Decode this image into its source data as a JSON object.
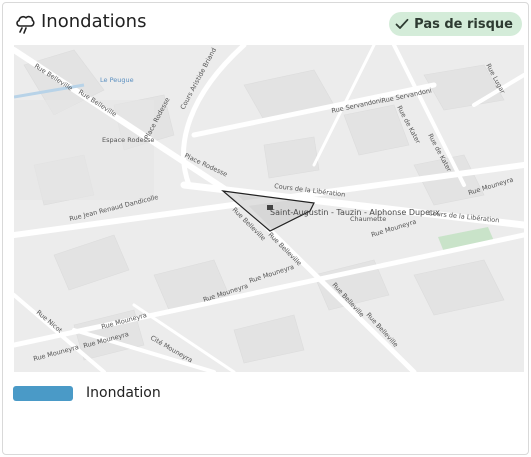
{
  "card": {
    "title": "Inondations",
    "title_icon": "cloud-rain-icon",
    "status": {
      "label": "Pas de risque",
      "icon": "check-icon",
      "color": "#d4ecd9"
    }
  },
  "map": {
    "parcel_label": "Saint-Augustin - Tauzin - Alphonse Dupeux",
    "district_label": "Chaumette",
    "landmarks": [
      "Le Peugue",
      "Espace Rodesse"
    ],
    "streets": [
      "Rue Belleville",
      "Rue Belleville",
      "Cours Aristide Briand",
      "Place Rodesse",
      "Rue Servandoni",
      "Rue Servandoni",
      "Rue Lugar",
      "Rue de Kater",
      "Rue de Kater",
      "Place Rodesse",
      "Cours de la Libération",
      "Cours de la Libération",
      "Rue Mouneyra",
      "Rue Jean Renaud Dandicolle",
      "Rue Belleville",
      "Rue Belleville",
      "Rue Mouneyra",
      "Rue Mouneyra",
      "Rue Mouneyra",
      "Rue Belleville",
      "Rue Belleville",
      "Rue Nicot",
      "Rue Mouneyra",
      "Rue Mouneyra",
      "Cité Mouneyra",
      "Rue Mouneyra"
    ]
  },
  "legend": {
    "label": "Inondation",
    "color": "#4a9ac7"
  }
}
